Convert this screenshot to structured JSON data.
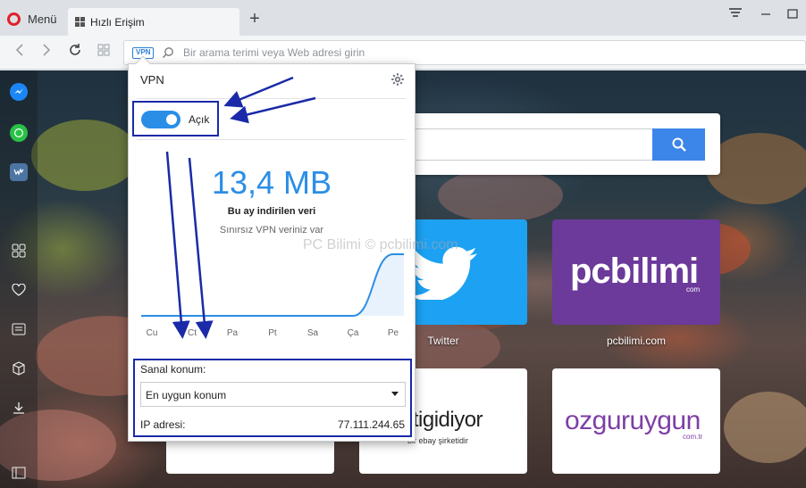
{
  "browser": {
    "menu_label": "Menü",
    "tab_title": "Hızlı Erişim",
    "new_tab_label": "+",
    "address_placeholder": "Bir arama terimi veya Web adresi girin",
    "vpn_badge": "VPN"
  },
  "vpn": {
    "title": "VPN",
    "toggle_label": "Açık",
    "toggle_on": true,
    "data_amount": "13,4 MB",
    "data_caption": "Bu ay indirilen veri",
    "unlimited_note": "Sınırsız VPN veriniz var",
    "days": [
      "Cu",
      "Ct",
      "Pa",
      "Pt",
      "Sa",
      "Ça",
      "Pe"
    ],
    "location_label": "Sanal konum:",
    "location_value": "En uygun konum",
    "ip_label": "IP adresi:",
    "ip_value": "77.111.244.65",
    "accent_color": "#2b8ee6"
  },
  "chart_data": {
    "type": "area",
    "x": [
      "Cu",
      "Ct",
      "Pa",
      "Pt",
      "Sa",
      "Ça",
      "Pe"
    ],
    "series": [
      {
        "values": [
          0,
          0,
          0,
          0,
          0,
          0,
          13.4
        ]
      }
    ],
    "xlabel": "",
    "ylabel": ""
  },
  "speed_dial": {
    "tiles": [
      {
        "label": "Twitter"
      },
      {
        "label": "pcbilimi.com",
        "logo": "pcbilimi",
        "logo_sub": "com"
      },
      {
        "label": "",
        "logo": "gittigidiyor",
        "logo_sub": "bir ebay şirketidir"
      },
      {
        "label": "",
        "logo": "ozguruygun",
        "logo_sub": "com.tr"
      }
    ]
  },
  "watermark": "PC Bilimi © pcbilimi.com",
  "sidebar_icons": [
    "messenger-icon",
    "whatsapp-icon",
    "vk-icon",
    "speed-dial-icon",
    "heart-icon",
    "news-icon",
    "box-icon",
    "download-icon",
    "sidebar-toggle-icon"
  ]
}
